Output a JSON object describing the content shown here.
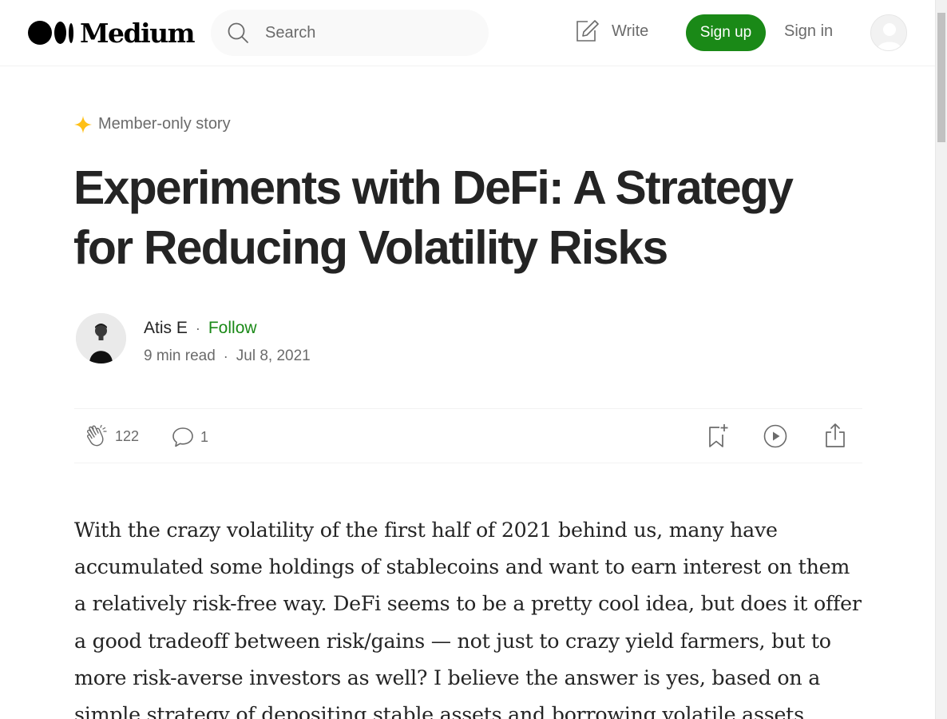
{
  "header": {
    "logo_text": "Medium",
    "search_placeholder": "Search",
    "write_label": "Write",
    "signup_label": "Sign up",
    "signin_label": "Sign in"
  },
  "article": {
    "member_badge": "Member-only story",
    "title": "Experiments with DeFi: A Strategy for Reducing Volatility Risks",
    "author": "Atis E",
    "follow_label": "Follow",
    "read_time": "9 min read",
    "date": "Jul 8, 2021",
    "claps": "122",
    "responses": "1",
    "body": "With the crazy volatility of the first half of 2021 behind us, many have accumulated some holdings of stablecoins and want to earn interest on them a relatively risk-free way. DeFi seems to be a pretty cool idea, but does it offer a good tradeoff between risk/gains — not just to crazy yield farmers, but to more risk-averse investors as well? I believe the answer is yes, based on a simple strategy of depositing stable assets and borrowing volatile assets"
  },
  "colors": {
    "brand_green": "#1a8917",
    "member_star": "#ffc017",
    "text_primary": "#242424",
    "text_secondary": "#6b6b6b"
  },
  "icons": [
    "medium-logo-icon",
    "search-icon",
    "write-icon",
    "user-avatar-icon",
    "member-star-icon",
    "clap-icon",
    "comment-icon",
    "bookmark-icon",
    "play-icon",
    "share-icon"
  ]
}
